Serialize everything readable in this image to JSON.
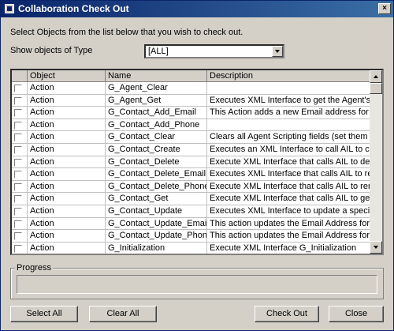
{
  "window": {
    "title": "Collaboration Check Out",
    "close_glyph": "×"
  },
  "instruction": "Select Objects from the list below that you wish to check out.",
  "filter": {
    "label": "Show objects of Type",
    "value": "[ALL]"
  },
  "table": {
    "headers": [
      "",
      "Object",
      "Name",
      "Description"
    ],
    "rows": [
      {
        "object": "Action",
        "name": "G_Agent_Clear",
        "description": ""
      },
      {
        "object": "Action",
        "name": "G_Agent_Get",
        "description": "Executes XML Interface to get the Agent's In"
      },
      {
        "object": "Action",
        "name": "G_Contact_Add_Email",
        "description": "This Action adds a new Email address for a s"
      },
      {
        "object": "Action",
        "name": "G_Contact_Add_Phone",
        "description": ""
      },
      {
        "object": "Action",
        "name": "G_Contact_Clear",
        "description": "Clears all Agent Scripting fields (set them to \"\""
      },
      {
        "object": "Action",
        "name": "G_Contact_Create",
        "description": "Executes an XML Interface to call AIL to crea"
      },
      {
        "object": "Action",
        "name": "G_Contact_Delete",
        "description": "Execute XML Interface that calls AIL to delet"
      },
      {
        "object": "Action",
        "name": "G_Contact_Delete_Email",
        "description": "Executes XML Interface that calls AIL to rem"
      },
      {
        "object": "Action",
        "name": "G_Contact_Delete_Phone",
        "description": "Execute XML Interface that calls AIL to rem"
      },
      {
        "object": "Action",
        "name": "G_Contact_Get",
        "description": "Execute XML Interface that calls AIL to get th"
      },
      {
        "object": "Action",
        "name": "G_Contact_Update",
        "description": "Executes XML Interface to update a specific"
      },
      {
        "object": "Action",
        "name": "G_Contact_Update_Email",
        "description": "This action updates the Email Address for a s"
      },
      {
        "object": "Action",
        "name": "G_Contact_Update_Phone",
        "description": "This action updates the Email Address for a s"
      },
      {
        "object": "Action",
        "name": "G_Initialization",
        "description": "Execute XML Interface G_Initialization"
      }
    ]
  },
  "progress": {
    "label": "Progress",
    "value": 0
  },
  "buttons": {
    "select_all": "Select All",
    "clear_all": "Clear All",
    "check_out": "Check Out",
    "close": "Close"
  }
}
